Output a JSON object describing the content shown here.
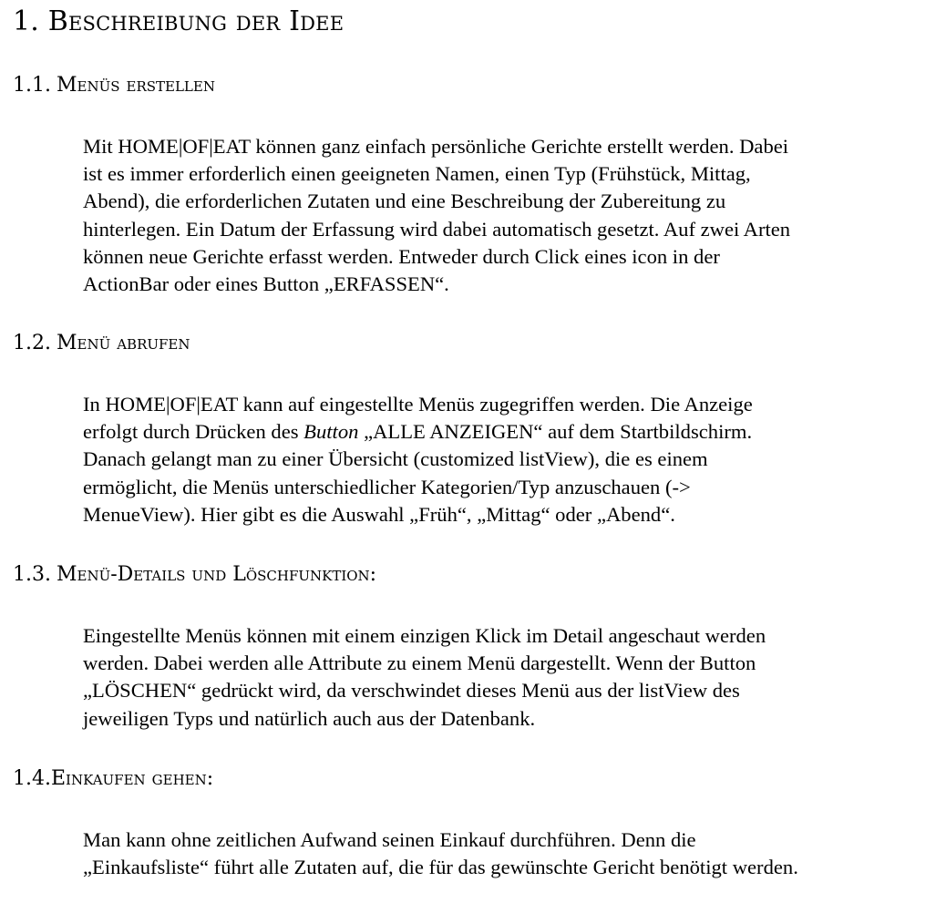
{
  "section": {
    "number": "1.",
    "title": "Beschreibung der Idee"
  },
  "subsections": [
    {
      "number": "1.1.",
      "title": "Menüs erstellen",
      "lines": [
        "Mit HOME|OF|EAT können ganz einfach persönliche Gerichte erstellt werden. Dabei",
        "ist es immer erforderlich einen geeigneten Namen, einen Typ (Frühstück, Mittag,",
        "Abend),  die erforderlichen Zutaten und eine Beschreibung der Zubereitung zu",
        "hinterlegen. Ein Datum der Erfassung wird dabei automatisch gesetzt. Auf zwei Arten",
        "können neue Gerichte erfasst werden. Entweder durch Click eines icon in der",
        "ActionBar oder eines Button „ERFASSEN“."
      ]
    },
    {
      "number": "1.2.",
      "title": "Menü abrufen",
      "lines": [
        "In HOME|OF|EAT kann auf eingestellte Menüs zugegriffen werden. Die Anzeige",
        {
          "before": "erfolgt durch Drücken des ",
          "italic": "Button",
          "after": " „ALLE ANZEIGEN“ auf dem Startbildschirm."
        },
        "Danach gelangt man zu einer Übersicht (customized listView), die es einem",
        "ermöglicht, die Menüs unterschiedlicher Kategorien/Typ anzuschauen (->",
        "MenueView). Hier gibt es die Auswahl „Früh“, „Mittag“ oder „Abend“."
      ]
    },
    {
      "number": "1.3.",
      "title": "Menü-Details und Löschfunktion:",
      "lines": [
        "Eingestellte Menüs können mit einem einzigen Klick im Detail angeschaut werden",
        "werden. Dabei werden alle Attribute zu einem Menü dargestellt. Wenn der Button",
        "„LÖSCHEN“ gedrückt wird, da verschwindet dieses Menü aus der listView des",
        "jeweiligen Typs und natürlich auch aus der Datenbank."
      ]
    },
    {
      "number": "1.4.",
      "title": "Einkaufen gehen:",
      "lines": [
        "Man kann ohne zeitlichen Aufwand seinen Einkauf durchführen. Denn die",
        "„Einkaufsliste“ führt alle Zutaten auf, die für das gewünschte Gericht benötigt werden."
      ]
    }
  ]
}
